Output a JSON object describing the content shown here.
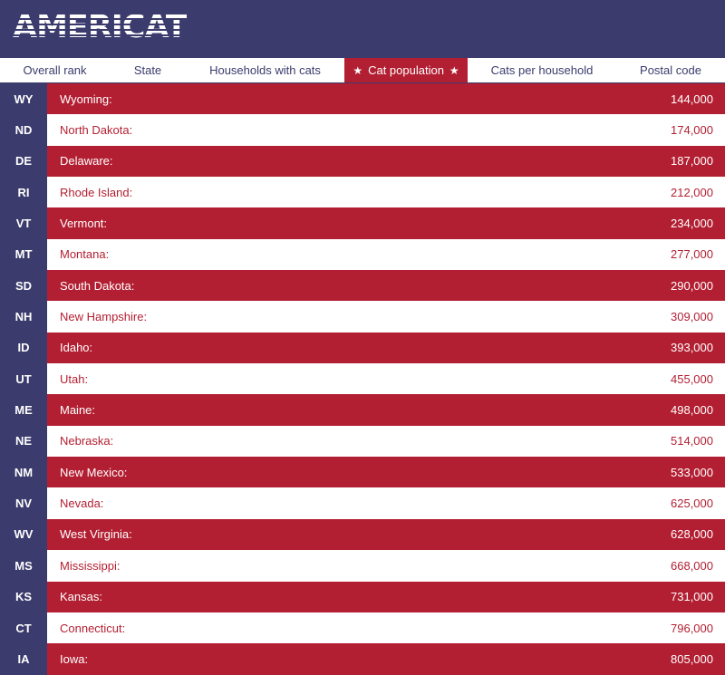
{
  "app": {
    "logo_text": "AMERICAT"
  },
  "tabs": [
    {
      "label": "Overall rank",
      "active": false
    },
    {
      "label": "State",
      "active": false
    },
    {
      "label": "Households with cats",
      "active": false
    },
    {
      "label": "Cat population",
      "active": true
    },
    {
      "label": "Cats per household",
      "active": false
    },
    {
      "label": "Postal code",
      "active": false
    }
  ],
  "tab_star": "★",
  "colors": {
    "navy": "#3b3b6d",
    "red": "#b31f32",
    "white": "#ffffff"
  },
  "rows": [
    {
      "code": "WY",
      "state": "Wyoming:",
      "value": "144,000"
    },
    {
      "code": "ND",
      "state": "North Dakota:",
      "value": "174,000"
    },
    {
      "code": "DE",
      "state": "Delaware:",
      "value": "187,000"
    },
    {
      "code": "RI",
      "state": "Rhode Island:",
      "value": "212,000"
    },
    {
      "code": "VT",
      "state": "Vermont:",
      "value": "234,000"
    },
    {
      "code": "MT",
      "state": "Montana:",
      "value": "277,000"
    },
    {
      "code": "SD",
      "state": "South Dakota:",
      "value": "290,000"
    },
    {
      "code": "NH",
      "state": "New Hampshire:",
      "value": "309,000"
    },
    {
      "code": "ID",
      "state": "Idaho:",
      "value": "393,000"
    },
    {
      "code": "UT",
      "state": "Utah:",
      "value": "455,000"
    },
    {
      "code": "ME",
      "state": "Maine:",
      "value": "498,000"
    },
    {
      "code": "NE",
      "state": "Nebraska:",
      "value": "514,000"
    },
    {
      "code": "NM",
      "state": "New Mexico:",
      "value": "533,000"
    },
    {
      "code": "NV",
      "state": "Nevada:",
      "value": "625,000"
    },
    {
      "code": "WV",
      "state": "West Virginia:",
      "value": "628,000"
    },
    {
      "code": "MS",
      "state": "Mississippi:",
      "value": "668,000"
    },
    {
      "code": "KS",
      "state": "Kansas:",
      "value": "731,000"
    },
    {
      "code": "CT",
      "state": "Connecticut:",
      "value": "796,000"
    },
    {
      "code": "IA",
      "state": "Iowa:",
      "value": "805,000"
    }
  ]
}
